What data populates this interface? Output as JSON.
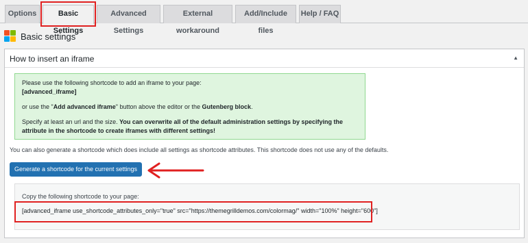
{
  "tabs": [
    "Options",
    "Basic Settings",
    "Advanced Settings",
    "External workaround",
    "Add/Include files",
    "Help / FAQ"
  ],
  "active_tab": "Basic Settings",
  "page_heading": "Basic settings",
  "section": {
    "title": "How to insert an iframe",
    "toggle_icon": "▲"
  },
  "info_box": {
    "line1": "Please use the following shortcode to add an iframe to your page:",
    "shortcode": "[advanced_iframe]",
    "line2_prefix": "or use the \"",
    "line2_bold1": "Add advanced iframe",
    "line2_mid": "\" button above the editor or the ",
    "line2_bold2": "Gutenberg block",
    "line2_suffix": ".",
    "line3_prefix": "Specify at least an url and the size. ",
    "line3_bold": "You can overwrite all of the default administration settings by specifying the attribute in the shortcode to create iframes with different settings!"
  },
  "description": "You can also generate a shortcode which does include all settings as shortcode attributes. This shortcode does not use any of the defaults.",
  "generate_button": "Generate a shortcode for the current settings",
  "copy_label": "Copy the following shortcode to your page:",
  "generated_shortcode": "[advanced_iframe use_shortcode_attributes_only=\"true\" src=\"https://themegrilldemos.com/colormag/\" width=\"100%\" height=\"600\"]",
  "colors": {
    "accent": "#2271b1",
    "highlight": "#e02020",
    "info_bg": "#dff5df",
    "info_border": "#8fd88f"
  }
}
